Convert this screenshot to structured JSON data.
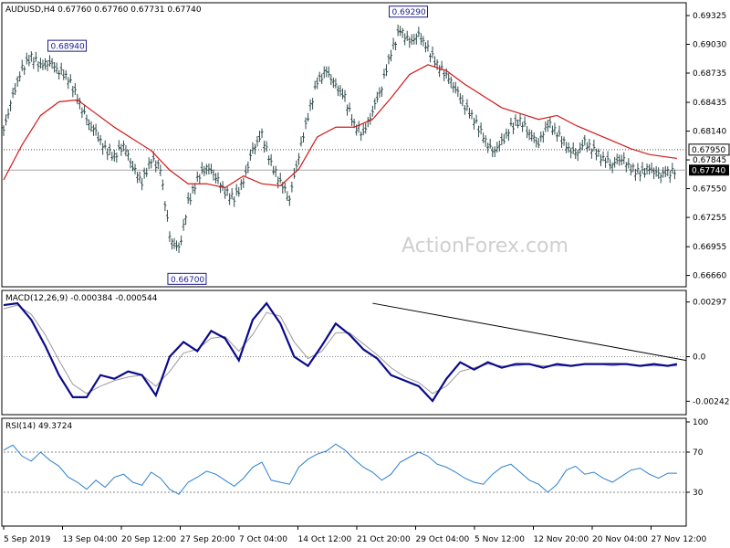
{
  "chart_data": {
    "type": "line",
    "symbol": "AUDUSD,H4",
    "ohlc": {
      "open": "0.67760",
      "high": "0.67760",
      "low": "0.67731",
      "close": "0.67740"
    },
    "watermark": "ActionForex.com",
    "colors": {
      "bars": "#2e4a4a",
      "ma": "#d11919",
      "macd": "#0a0a8c",
      "signal": "#9a9a9a",
      "rsi": "#2a7fcf",
      "trendline": "#000000",
      "level": "#555555"
    },
    "x_ticks": [
      "5 Sep 2019",
      "13 Sep 04:00",
      "20 Sep 12:00",
      "27 Sep 20:00",
      "7 Oct 04:00",
      "14 Oct 12:00",
      "21 Oct 20:00",
      "29 Oct 04:00",
      "5 Nov 12:00",
      "12 Nov 20:00",
      "20 Nov 04:00",
      "27 Nov 12:00"
    ],
    "price_panel": {
      "y_ticks": [
        "0.69325",
        "0.69030",
        "0.68735",
        "0.68435",
        "0.68140",
        "0.67845",
        "0.67550",
        "0.67255",
        "0.66955",
        "0.66660"
      ],
      "ylim": [
        0.666,
        0.694
      ],
      "current_price": "0.67740",
      "resistance_level": "0.67950",
      "annotations": [
        {
          "label": "0.68940",
          "x": 10,
          "price": 0.6894
        },
        {
          "label": "0.66700",
          "x": 36,
          "price": 0.667
        },
        {
          "label": "0.69290",
          "x": 84,
          "price": 0.6929
        }
      ],
      "series": [
        {
          "name": "price",
          "x": [
            0,
            2,
            4,
            6,
            8,
            10,
            12,
            14,
            16,
            18,
            20,
            22,
            24,
            26,
            28,
            30,
            32,
            34,
            36,
            38,
            40,
            42,
            44,
            46,
            48,
            50,
            52,
            54,
            56,
            58,
            60,
            62,
            64,
            66,
            68,
            70,
            72,
            74,
            76,
            78,
            80,
            82,
            84,
            86,
            88,
            90,
            92,
            94,
            96,
            98,
            100,
            102,
            104,
            106,
            108,
            110,
            112,
            114,
            116,
            118,
            120,
            122,
            124,
            126,
            128,
            130,
            132,
            134,
            136,
            138,
            140,
            142,
            144,
            146
          ],
          "y": [
            0.6815,
            0.685,
            0.6878,
            0.689,
            0.6882,
            0.6885,
            0.6876,
            0.6868,
            0.6848,
            0.6825,
            0.6812,
            0.6795,
            0.6788,
            0.68,
            0.6778,
            0.6762,
            0.6785,
            0.6775,
            0.6705,
            0.6692,
            0.674,
            0.6765,
            0.6778,
            0.6768,
            0.6752,
            0.6745,
            0.6762,
            0.6795,
            0.681,
            0.678,
            0.6762,
            0.6745,
            0.679,
            0.683,
            0.6865,
            0.6875,
            0.686,
            0.6848,
            0.682,
            0.6812,
            0.6835,
            0.686,
            0.6895,
            0.6918,
            0.6905,
            0.6912,
            0.6898,
            0.6882,
            0.6872,
            0.6858,
            0.684,
            0.6826,
            0.6808,
            0.6792,
            0.6802,
            0.6818,
            0.6825,
            0.6812,
            0.6802,
            0.6822,
            0.6812,
            0.6798,
            0.679,
            0.6802,
            0.6794,
            0.6786,
            0.678,
            0.6787,
            0.6776,
            0.6771,
            0.6775,
            0.6769,
            0.6771,
            0.6774
          ]
        },
        {
          "name": "ma",
          "x": [
            0,
            4,
            8,
            12,
            16,
            20,
            24,
            28,
            32,
            36,
            40,
            44,
            48,
            52,
            56,
            60,
            64,
            68,
            72,
            76,
            80,
            84,
            88,
            92,
            96,
            100,
            104,
            108,
            112,
            116,
            120,
            124,
            128,
            132,
            136,
            140,
            146
          ],
          "y": [
            0.6764,
            0.68,
            0.683,
            0.6844,
            0.6846,
            0.6832,
            0.6818,
            0.6806,
            0.6794,
            0.6774,
            0.676,
            0.676,
            0.6756,
            0.6768,
            0.676,
            0.6758,
            0.6775,
            0.6808,
            0.6818,
            0.6818,
            0.6826,
            0.6848,
            0.6872,
            0.6882,
            0.6876,
            0.6862,
            0.685,
            0.6838,
            0.6832,
            0.6826,
            0.683,
            0.682,
            0.6812,
            0.6804,
            0.6796,
            0.679,
            0.6786
          ]
        }
      ]
    },
    "macd_panel": {
      "title": "MACD(12,26,9) -0.000384 -0.000544",
      "y_ticks": [
        "0.00297",
        "0.0",
        "-0.00242"
      ],
      "ylim": [
        -0.00275,
        0.0033
      ],
      "series": [
        {
          "name": "macd",
          "x": [
            0,
            3,
            6,
            9,
            12,
            15,
            18,
            21,
            24,
            27,
            30,
            33,
            36,
            39,
            42,
            45,
            48,
            51,
            54,
            57,
            60,
            63,
            66,
            69,
            72,
            75,
            78,
            81,
            84,
            87,
            90,
            93,
            96,
            99,
            102,
            105,
            108,
            111,
            114,
            117,
            120,
            123,
            126,
            129,
            132,
            135,
            138,
            141,
            144,
            146
          ],
          "y": [
            0.0028,
            0.0029,
            0.002,
            0.0006,
            -0.001,
            -0.0022,
            -0.0022,
            -0.001,
            -0.0012,
            -0.0008,
            -0.001,
            -0.0021,
            0.0,
            0.0008,
            0.0003,
            0.0014,
            0.001,
            -0.0002,
            0.002,
            0.0029,
            0.0018,
            0.0,
            -0.0005,
            0.0006,
            0.0018,
            0.0012,
            0.0004,
            -0.0001,
            -0.001,
            -0.0013,
            -0.0016,
            -0.0024,
            -0.0012,
            -0.0003,
            -0.0007,
            -0.0003,
            -0.0006,
            -0.0004,
            -0.0004,
            -0.0006,
            -0.0004,
            -0.0005,
            -0.0004,
            -0.0004,
            -0.0004,
            -0.0004,
            -0.0005,
            -0.0004,
            -0.0005,
            -0.0004
          ]
        },
        {
          "name": "signal",
          "x": [
            0,
            3,
            6,
            9,
            12,
            15,
            18,
            21,
            24,
            27,
            30,
            33,
            36,
            39,
            42,
            45,
            48,
            51,
            54,
            57,
            60,
            63,
            66,
            69,
            72,
            75,
            78,
            81,
            84,
            87,
            90,
            93,
            96,
            99,
            102,
            105,
            108,
            111,
            114,
            117,
            120,
            123,
            126,
            129,
            132,
            135,
            138,
            141,
            144,
            146
          ],
          "y": [
            0.0026,
            0.0028,
            0.0023,
            0.0012,
            -0.0002,
            -0.0015,
            -0.002,
            -0.0016,
            -0.0013,
            -0.0011,
            -0.001,
            -0.0016,
            -0.0008,
            0.0002,
            0.0004,
            0.001,
            0.0011,
            0.0003,
            0.0012,
            0.0024,
            0.0022,
            0.0008,
            -0.0001,
            0.0003,
            0.0013,
            0.0013,
            0.0007,
            0.0001,
            -0.0006,
            -0.0011,
            -0.0014,
            -0.002,
            -0.0016,
            -0.0008,
            -0.0006,
            -0.0004,
            -0.0005,
            -0.0005,
            -0.0004,
            -0.0005,
            -0.0005,
            -0.0005,
            -0.0004,
            -0.0004,
            -0.0005,
            -0.0004,
            -0.0005,
            -0.0005,
            -0.0005,
            -0.0005
          ]
        },
        {
          "name": "trendline",
          "x": [
            80,
            148
          ],
          "y": [
            0.0029,
            -0.0002
          ]
        }
      ]
    },
    "rsi_panel": {
      "title": "RSI(14) 49.3724",
      "y_ticks": [
        "100",
        "70",
        "30"
      ],
      "ylim": [
        0,
        100
      ],
      "levels": [
        70,
        30
      ],
      "series": [
        {
          "name": "rsi",
          "x": [
            0,
            2,
            4,
            6,
            8,
            10,
            12,
            14,
            16,
            18,
            20,
            22,
            24,
            26,
            28,
            30,
            32,
            34,
            36,
            38,
            40,
            42,
            44,
            46,
            48,
            50,
            52,
            54,
            56,
            58,
            60,
            62,
            64,
            66,
            68,
            70,
            72,
            74,
            76,
            78,
            80,
            82,
            84,
            86,
            88,
            90,
            92,
            94,
            96,
            98,
            100,
            102,
            104,
            106,
            108,
            110,
            112,
            114,
            116,
            118,
            120,
            122,
            124,
            126,
            128,
            130,
            132,
            134,
            136,
            138,
            140,
            142,
            144,
            146
          ],
          "y": [
            72,
            77,
            66,
            61,
            70,
            62,
            56,
            45,
            40,
            33,
            42,
            35,
            45,
            48,
            40,
            37,
            50,
            44,
            33,
            28,
            40,
            45,
            51,
            48,
            42,
            36,
            44,
            55,
            60,
            42,
            40,
            38,
            55,
            63,
            68,
            71,
            78,
            72,
            63,
            55,
            50,
            42,
            48,
            60,
            65,
            70,
            66,
            58,
            55,
            50,
            44,
            40,
            38,
            48,
            55,
            58,
            50,
            42,
            38,
            30,
            38,
            52,
            56,
            48,
            50,
            44,
            40,
            46,
            52,
            54,
            48,
            44,
            49,
            49
          ]
        }
      ]
    }
  }
}
